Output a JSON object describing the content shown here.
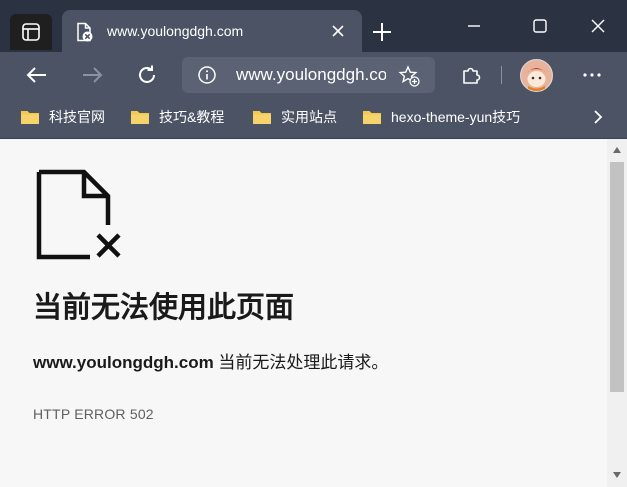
{
  "colors": {
    "titlebar": "#2b3342",
    "tab_active": "#4b5364",
    "toolbar": "#4b5364",
    "page_bg": "#f7f7f7",
    "folder": "#f2c94c"
  },
  "tab": {
    "title": "www.youlongdgh.com",
    "favicon": "error-page-icon"
  },
  "address_bar": {
    "url": "www.youlongdgh.com"
  },
  "favorites": [
    {
      "label": "科技官网",
      "icon": "folder-icon"
    },
    {
      "label": "技巧&教程",
      "icon": "folder-icon"
    },
    {
      "label": "实用站点",
      "icon": "folder-icon"
    },
    {
      "label": "hexo-theme-yun技巧",
      "icon": "folder-icon"
    }
  ],
  "page": {
    "title": "当前无法使用此页面",
    "description_host": "www.youlongdgh.com",
    "description_text": " 当前无法处理此请求。",
    "error_code": "HTTP ERROR 502"
  }
}
